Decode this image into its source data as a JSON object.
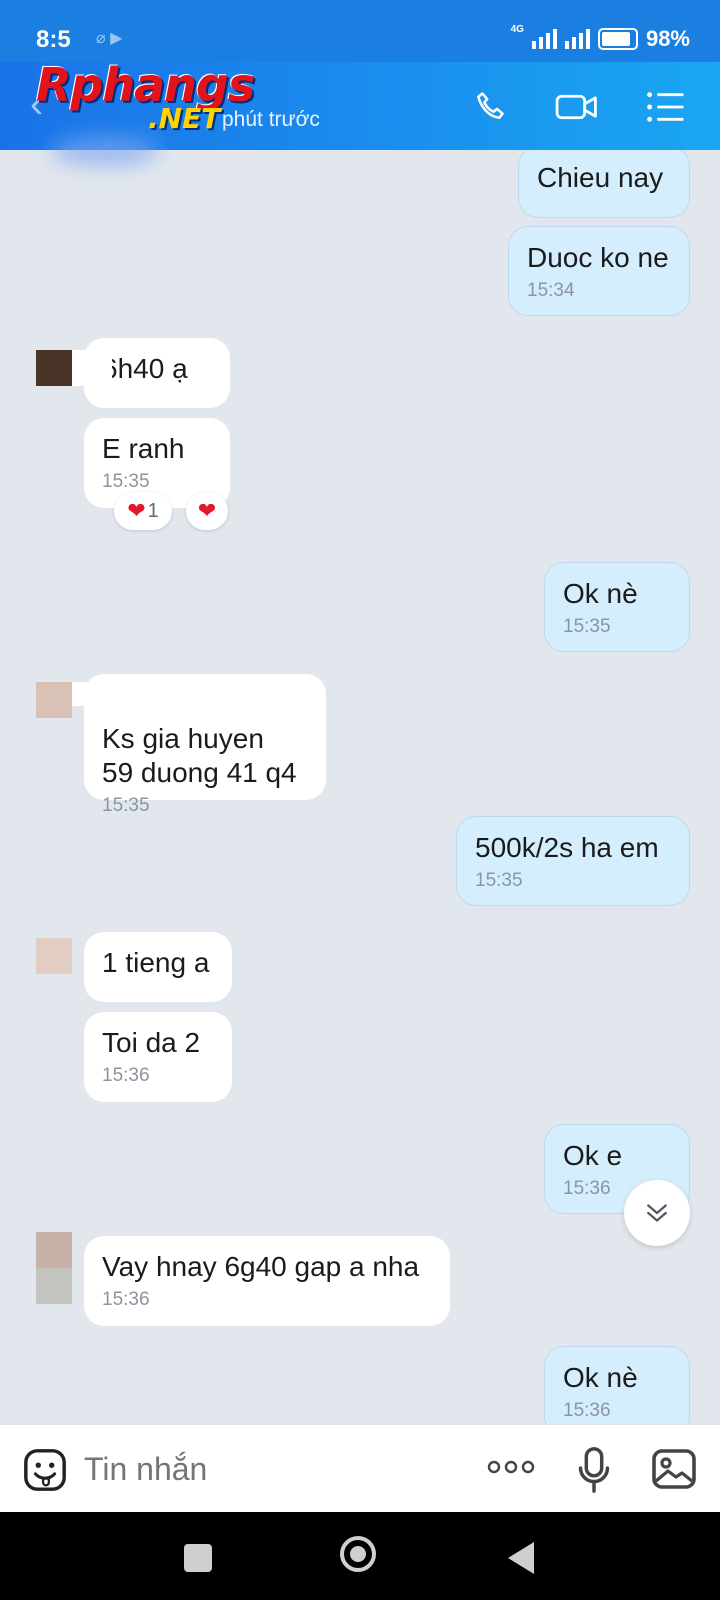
{
  "status_bar": {
    "time": "8:5",
    "network": "4G",
    "battery": "98%"
  },
  "header": {
    "logo_main": "Rphangs",
    "logo_sub": ".NET",
    "subtitle": "phút trước"
  },
  "messages": [
    {
      "text": "Chieu nay",
      "time": ""
    },
    {
      "text": "Duoc ko ne",
      "time": "15:34"
    },
    {
      "text": "6h40 ạ",
      "time": ""
    },
    {
      "text": "E ranh",
      "time": "15:35",
      "reaction_count": "1"
    },
    {
      "text": "Ok nè",
      "time": "15:35"
    },
    {
      "text": "Ks gia huyen\n59 duong 41 q4",
      "time": "15:35"
    },
    {
      "text": "500k/2s ha em",
      "time": "15:35"
    },
    {
      "text": "1 tieng a",
      "time": ""
    },
    {
      "text": "Toi da 2",
      "time": "15:36"
    },
    {
      "text": "Ok e",
      "time": "15:36"
    },
    {
      "text": "Vay hnay 6g40 gap a nha",
      "time": "15:36"
    },
    {
      "text": "Ok nè",
      "time": "15:36"
    }
  ],
  "input": {
    "placeholder": "Tin nhắn"
  },
  "colors": {
    "header_start": "#1a72e8",
    "header_end": "#1aa6f2",
    "outgoing_bubble": "#d5eefd",
    "incoming_bubble": "#ffffff",
    "chat_bg": "#e2e7ee"
  }
}
